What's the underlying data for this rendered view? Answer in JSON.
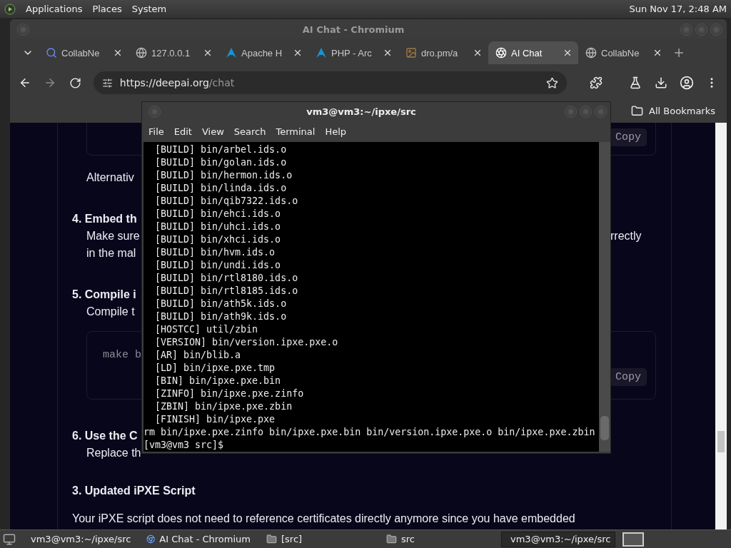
{
  "top_panel": {
    "menus": [
      "Applications",
      "Places",
      "System"
    ],
    "clock": "Sun Nov 17, 2:48 AM"
  },
  "browser": {
    "title": "AI Chat - Chromium",
    "tabs": [
      {
        "label": "CollabNe",
        "kind": "search",
        "selected": false
      },
      {
        "label": "127.0.0.1",
        "kind": "globe",
        "selected": false
      },
      {
        "label": "Apache H",
        "kind": "arch",
        "selected": false
      },
      {
        "label": "PHP - Arc",
        "kind": "arch",
        "selected": false
      },
      {
        "label": "dro.pm/a",
        "kind": "image",
        "selected": false
      },
      {
        "label": "AI Chat",
        "kind": "swirl",
        "selected": true
      },
      {
        "label": "CollabNe",
        "kind": "globe",
        "selected": false
      }
    ],
    "url": {
      "host": "https://deepai.org",
      "path": "/chat"
    },
    "bookmarks": "All Bookmarks"
  },
  "chat": [
    {
      "kind": "code",
      "open_top": true,
      "button": "Copy"
    },
    {
      "kind": "step_text",
      "left": "Alternativ"
    },
    {
      "kind": "step_title",
      "left": "4. Embed th"
    },
    {
      "kind": "step_text",
      "left": "Make sure",
      "right": "rrectly"
    },
    {
      "kind": "step_text",
      "left": "in the mal"
    },
    {
      "kind": "step_title",
      "left": "5. Compile i"
    },
    {
      "kind": "step_text",
      "left": "Compile t"
    },
    {
      "kind": "code",
      "open_top": false,
      "code": "make b",
      "button": "Copy"
    },
    {
      "kind": "step_title",
      "left": "6. Use the C"
    },
    {
      "kind": "step_text",
      "left": "Replace th"
    },
    {
      "kind": "section_title",
      "left": "3. Updated iPXE Script"
    },
    {
      "kind": "paragraph",
      "left": "Your iPXE script does not need to reference certificates directly anymore since you have embedded"
    }
  ],
  "terminal": {
    "title": "vm3@vm3:~/ipxe/src",
    "menus": [
      "File",
      "Edit",
      "View",
      "Search",
      "Terminal",
      "Help"
    ],
    "lines": [
      "  [BUILD] bin/arbel.ids.o",
      "  [BUILD] bin/golan.ids.o",
      "  [BUILD] bin/hermon.ids.o",
      "  [BUILD] bin/linda.ids.o",
      "  [BUILD] bin/qib7322.ids.o",
      "  [BUILD] bin/ehci.ids.o",
      "  [BUILD] bin/uhci.ids.o",
      "  [BUILD] bin/xhci.ids.o",
      "  [BUILD] bin/hvm.ids.o",
      "  [BUILD] bin/undi.ids.o",
      "  [BUILD] bin/rtl8180.ids.o",
      "  [BUILD] bin/rtl8185.ids.o",
      "  [BUILD] bin/ath5k.ids.o",
      "  [BUILD] bin/ath9k.ids.o",
      "  [HOSTCC] util/zbin",
      "  [VERSION] bin/version.ipxe.pxe.o",
      "  [AR] bin/blib.a",
      "  [LD] bin/ipxe.pxe.tmp",
      "  [BIN] bin/ipxe.pxe.bin",
      "  [ZINFO] bin/ipxe.pxe.zinfo",
      "  [ZBIN] bin/ipxe.pxe.zbin",
      "  [FINISH] bin/ipxe.pxe",
      "rm bin/ipxe.pxe.zinfo bin/ipxe.pxe.bin bin/version.ipxe.pxe.o bin/ipxe.pxe.zbin",
      "[vm3@vm3 src]$"
    ]
  },
  "taskbar": [
    {
      "label": "vm3@vm3:~/ipxe/src",
      "kind": "terminal",
      "selected": false
    },
    {
      "label": "AI Chat - Chromium",
      "kind": "browser",
      "selected": false
    },
    {
      "label": "[src]",
      "kind": "folder",
      "selected": false
    },
    {
      "label": "src",
      "kind": "folder",
      "selected": false
    },
    {
      "label": "vm3@vm3:~/ipxe/src",
      "kind": "terminal",
      "selected": true
    }
  ]
}
